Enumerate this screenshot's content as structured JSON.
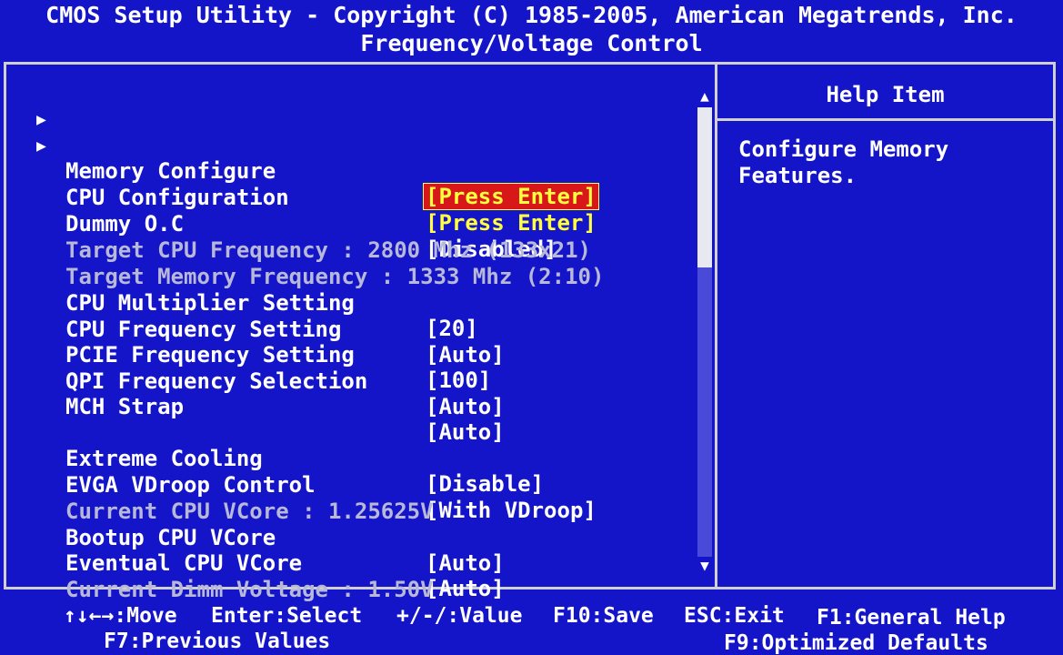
{
  "header": {
    "title": "CMOS Setup Utility - Copyright (C) 1985-2005, American Megatrends, Inc.",
    "subtitle": "Frequency/Voltage Control"
  },
  "help": {
    "title": "Help Item",
    "text": "Configure Memory\nFeatures."
  },
  "items": {
    "memory_configure": {
      "label": "Memory Configure",
      "value": "[Press Enter]"
    },
    "cpu_configuration": {
      "label": "CPU Configuration",
      "value": "[Press Enter]"
    },
    "dummy_oc": {
      "label": "Dummy O.C",
      "value": "[Disabled]"
    },
    "target_cpu_freq": {
      "label": "Target CPU Frequency : 2800 Mhz (133x21)"
    },
    "target_mem_freq": {
      "label": "Target Memory Frequency : 1333 Mhz (2:10)"
    },
    "cpu_multiplier": {
      "label": "CPU Multiplier Setting",
      "value": "[20]"
    },
    "cpu_frequency": {
      "label": "CPU Frequency Setting",
      "value": "[Auto]"
    },
    "pcie_frequency": {
      "label": "PCIE Frequency Setting",
      "value": "[100]"
    },
    "qpi_frequency": {
      "label": "QPI Frequency Selection",
      "value": "[Auto]"
    },
    "mch_strap": {
      "label": "MCH Strap",
      "value": "[Auto]"
    },
    "extreme_cooling": {
      "label": "Extreme Cooling",
      "value": "[Disable]"
    },
    "evga_vdroop": {
      "label": "EVGA VDroop Control",
      "value": "[With VDroop]"
    },
    "current_cpu_vcore": {
      "label": "Current CPU VCore : 1.25625V"
    },
    "bootup_cpu_vcore": {
      "label": "Bootup CPU VCore",
      "value": "[Auto]"
    },
    "eventual_cpu_vcore": {
      "label": "Eventual CPU VCore",
      "value": "[Auto]"
    },
    "current_dimm_voltage": {
      "label": "Current Dimm Voltage : 1.50V"
    }
  },
  "scrollbar": {
    "up": "▲",
    "down": "▼",
    "position_fraction": 0.0,
    "visible_fraction": 0.36
  },
  "footer": {
    "move": "↑↓←→:Move",
    "select": "Enter:Select",
    "value": "+/-/:Value",
    "save": "F10:Save",
    "exit": "ESC:Exit",
    "help": "F1:General Help",
    "previous": "F7:Previous Values",
    "defaults": "F9:Optimized Defaults"
  },
  "colors": {
    "background": "#1414c8",
    "text": "#ffffff",
    "highlight_value": "#ffff40",
    "selection": "#d81818"
  }
}
